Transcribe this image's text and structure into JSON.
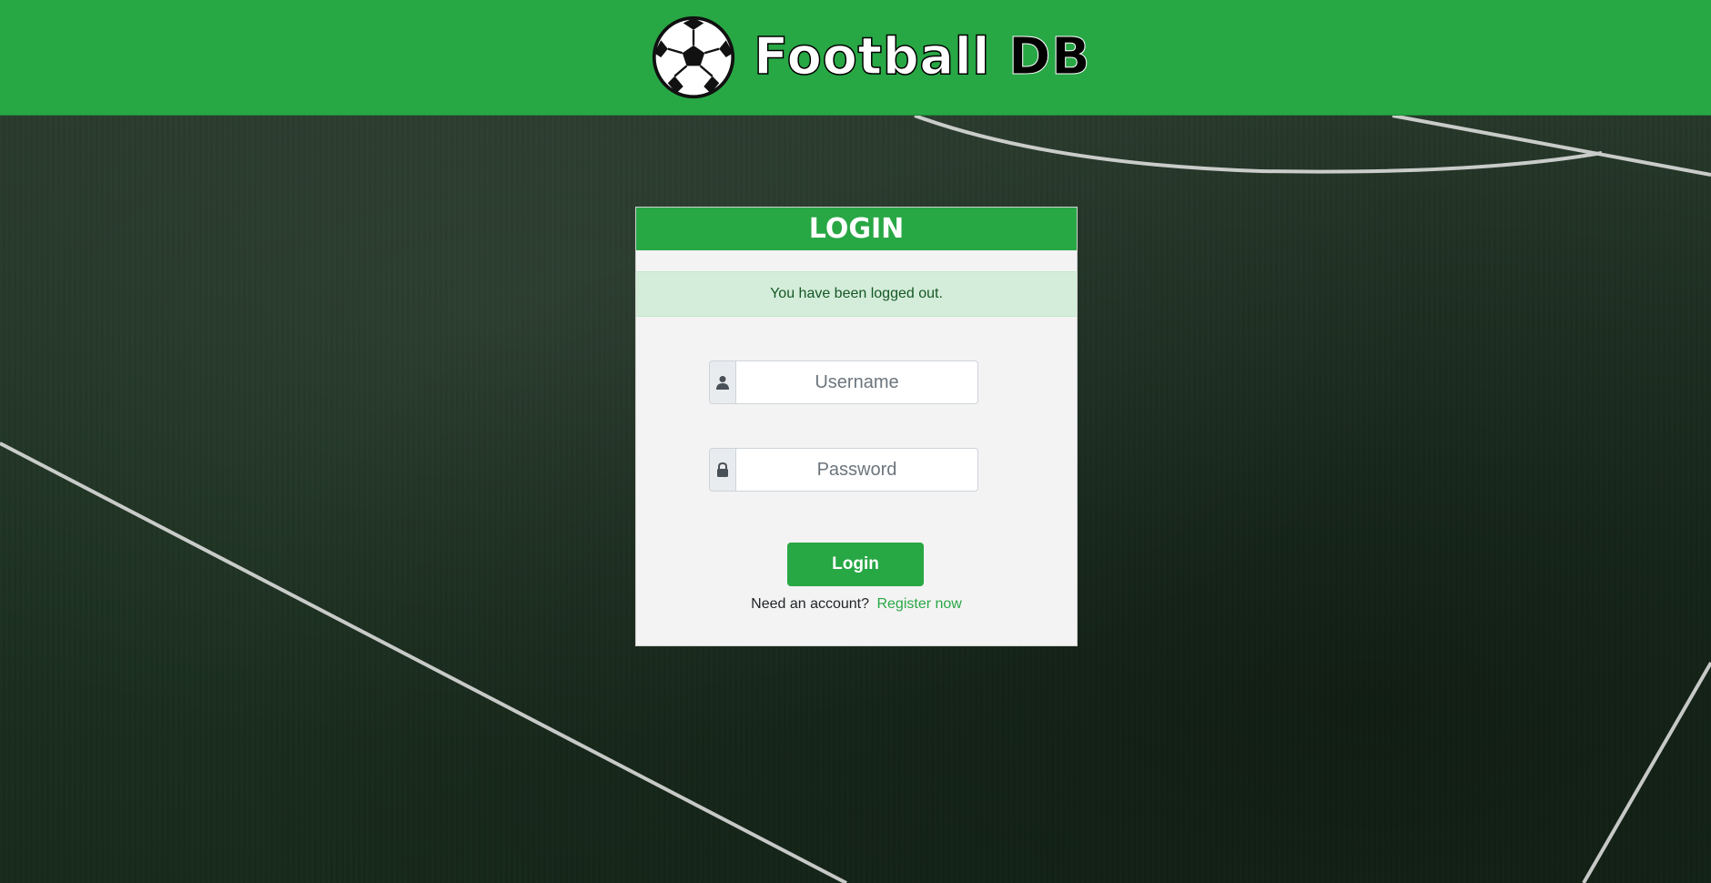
{
  "colors": {
    "brand_green": "#28a745",
    "card_bg": "#f3f3f3",
    "alert_bg": "#d4edda"
  },
  "header": {
    "logo_icon": "soccer-ball-icon",
    "brand_first": "Football",
    "brand_second": "DB"
  },
  "login_card": {
    "title": "LOGIN",
    "alert": "You have been logged out.",
    "username": {
      "icon": "user-icon",
      "placeholder": "Username",
      "value": ""
    },
    "password": {
      "icon": "lock-icon",
      "placeholder": "Password",
      "value": ""
    },
    "submit_label": "Login",
    "register_prompt": "Need an account?",
    "register_link": "Register now"
  }
}
